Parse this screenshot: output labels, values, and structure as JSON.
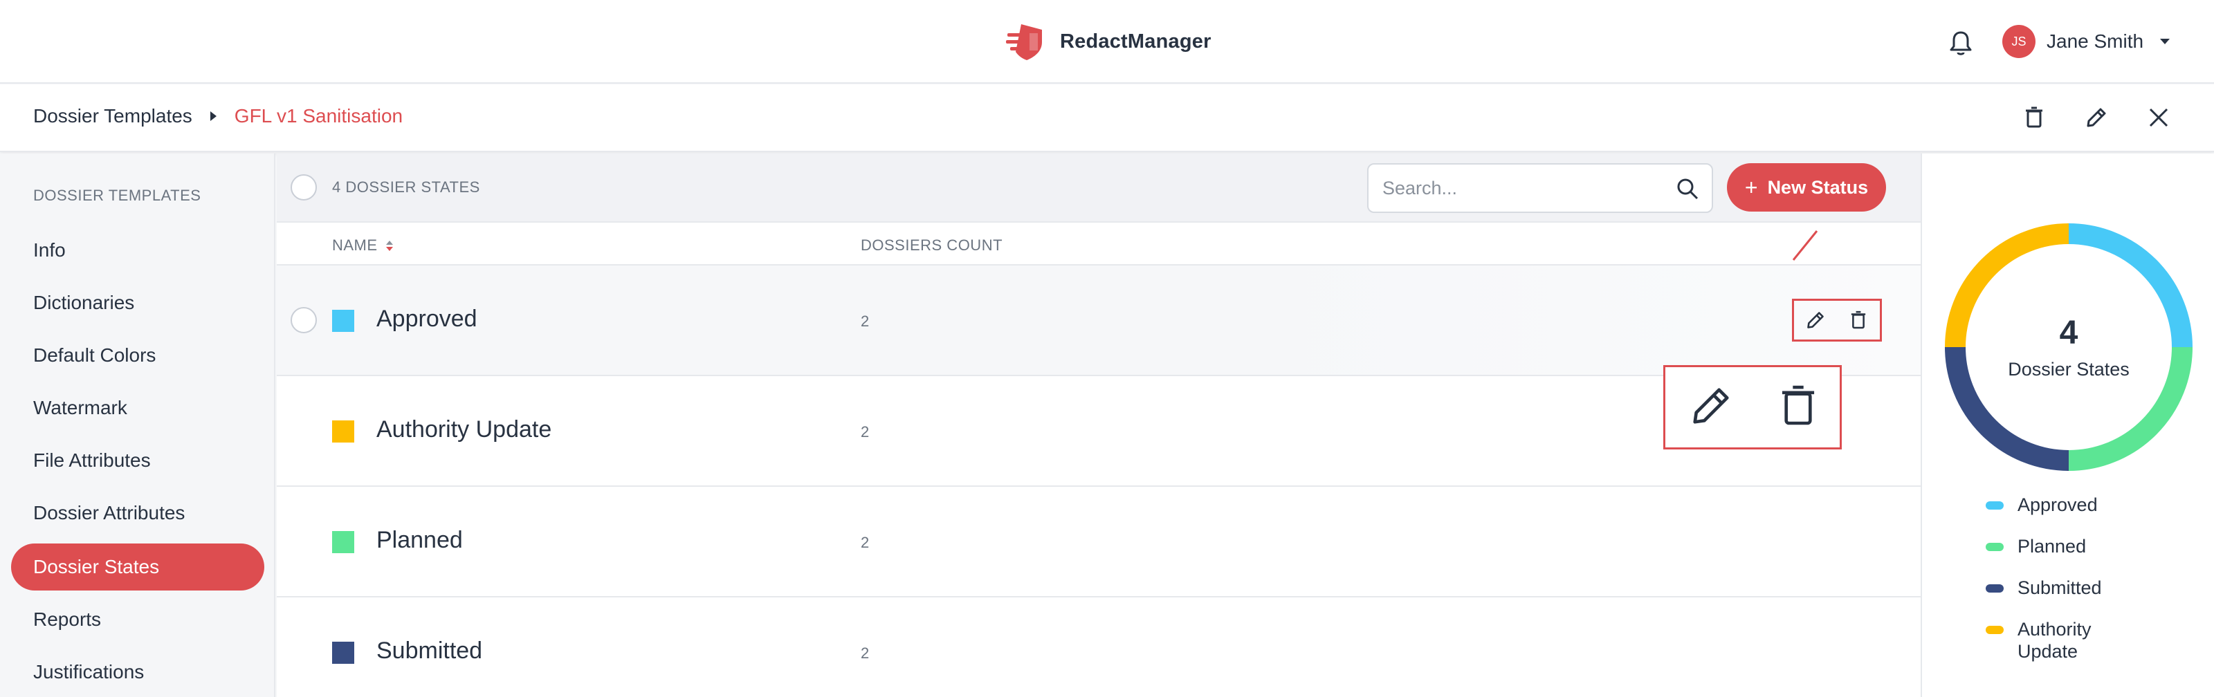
{
  "app": {
    "name": "RedactManager"
  },
  "user": {
    "initials": "JS",
    "name": "Jane Smith"
  },
  "breadcrumb": {
    "root": "Dossier Templates",
    "current": "GFL v1 Sanitisation"
  },
  "sidebar": {
    "section": "DOSSIER TEMPLATES",
    "items": [
      {
        "label": "Info"
      },
      {
        "label": "Dictionaries"
      },
      {
        "label": "Default Colors"
      },
      {
        "label": "Watermark"
      },
      {
        "label": "File Attributes"
      },
      {
        "label": "Dossier Attributes"
      },
      {
        "label": "Dossier States",
        "active": true
      },
      {
        "label": "Reports"
      },
      {
        "label": "Justifications"
      }
    ]
  },
  "toolbar": {
    "count_label": "4 DOSSIER STATES",
    "search_placeholder": "Search...",
    "new_button": "New Status"
  },
  "table": {
    "columns": [
      "NAME",
      "DOSSIERS COUNT"
    ],
    "rows": [
      {
        "name": "Approved",
        "count": "2",
        "color": "#48c9f7"
      },
      {
        "name": "Authority Update",
        "count": "2",
        "color": "#fdbd00"
      },
      {
        "name": "Planned",
        "count": "2",
        "color": "#5ce594"
      },
      {
        "name": "Submitted",
        "count": "2",
        "color": "#374c81"
      }
    ]
  },
  "summary": {
    "total": "4",
    "label": "Dossier States",
    "legend": [
      {
        "label": "Approved",
        "color": "#48c9f7"
      },
      {
        "label": "Planned",
        "color": "#5ce594"
      },
      {
        "label": "Submitted",
        "color": "#374c81"
      },
      {
        "label": "Authority Update",
        "color": "#fdbd00"
      }
    ]
  },
  "chart_data": {
    "type": "pie",
    "categories": [
      "Approved",
      "Planned",
      "Submitted",
      "Authority Update"
    ],
    "values": [
      1,
      1,
      1,
      1
    ],
    "colors": [
      "#48c9f7",
      "#5ce594",
      "#374c81",
      "#fdbd00"
    ],
    "donut": true
  },
  "colors": {
    "accent": "#dd4d50",
    "text": "#283241"
  }
}
